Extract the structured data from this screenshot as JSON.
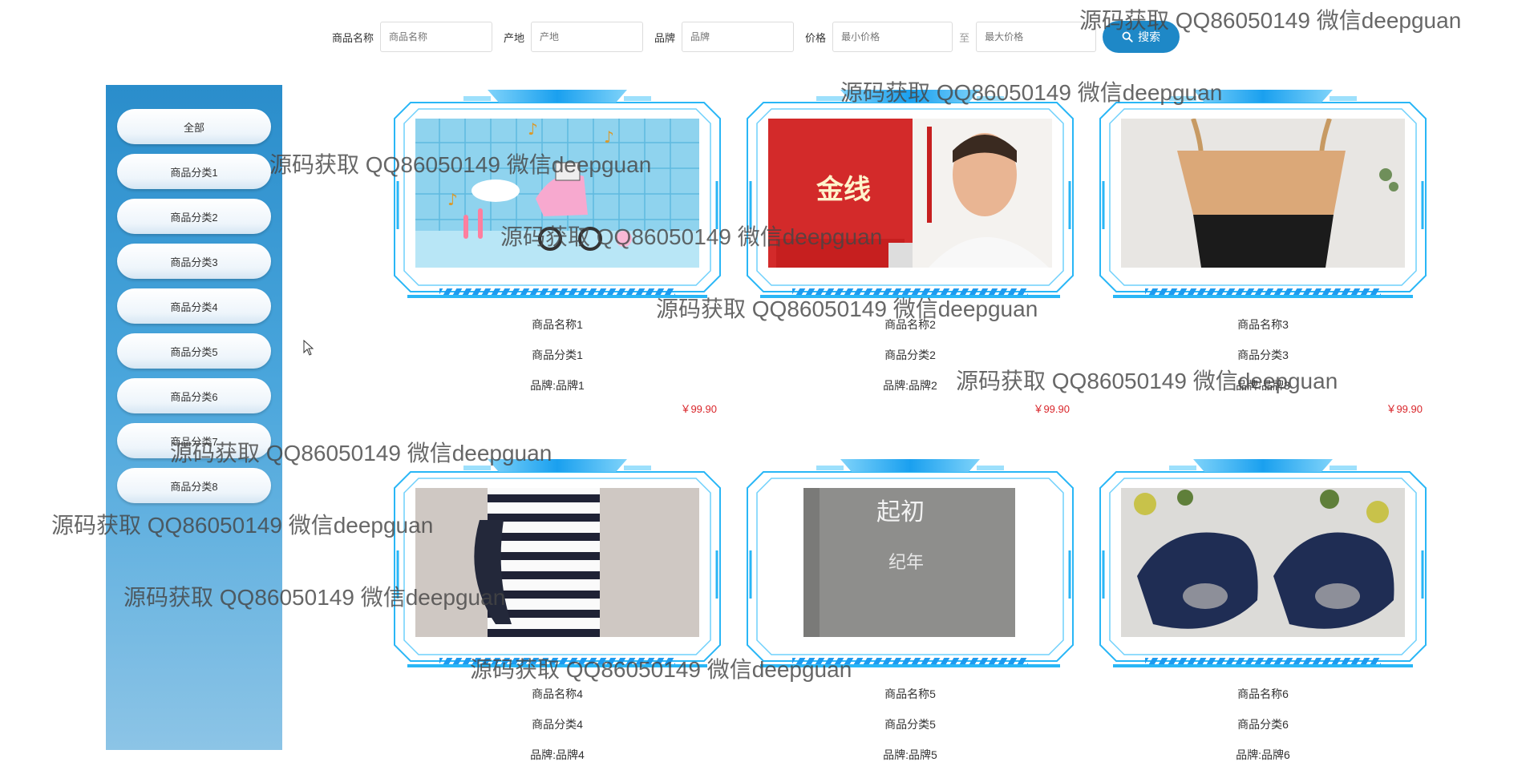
{
  "search": {
    "name_label": "商品名称",
    "name_placeholder": "商品名称",
    "origin_label": "产地",
    "origin_placeholder": "产地",
    "brand_label": "品牌",
    "brand_placeholder": "品牌",
    "price_label": "价格",
    "min_price_placeholder": "最小价格",
    "to_label": "至",
    "max_price_placeholder": "最大价格",
    "search_button": "搜索",
    "search_icon": "search-icon"
  },
  "sidebar": {
    "items": [
      {
        "label": "全部"
      },
      {
        "label": "商品分类1"
      },
      {
        "label": "商品分类2"
      },
      {
        "label": "商品分类3"
      },
      {
        "label": "商品分类4"
      },
      {
        "label": "商品分类5"
      },
      {
        "label": "商品分类6"
      },
      {
        "label": "商品分类7"
      },
      {
        "label": "商品分类8"
      }
    ]
  },
  "products": [
    {
      "name": "商品名称1",
      "category": "商品分类1",
      "brand": "品牌:品牌1",
      "price": "￥99.90",
      "image": "pink-stroller"
    },
    {
      "name": "商品名称2",
      "category": "商品分类2",
      "brand": "品牌:品牌2",
      "price": "￥99.90",
      "image": "book-jinxian"
    },
    {
      "name": "商品名称3",
      "category": "商品分类3",
      "brand": "品牌:品牌3",
      "price": "￥99.90",
      "image": "woven-bag"
    },
    {
      "name": "商品名称4",
      "category": "商品分类4",
      "brand": "品牌:品牌4",
      "price": "",
      "image": "striped-dress"
    },
    {
      "name": "商品名称5",
      "category": "商品分类5",
      "brand": "品牌:品牌5",
      "price": "",
      "image": "gray-book"
    },
    {
      "name": "商品名称6",
      "category": "商品分类6",
      "brand": "品牌:品牌6",
      "price": "",
      "image": "navy-shoes"
    }
  ],
  "image_text": {
    "book_title": "金线",
    "gray_book_title": "起初",
    "gray_book_sub": "纪年"
  },
  "watermark": "源码获取 QQ86050149 微信deepguan",
  "colors": {
    "accent": "#1e88c7",
    "sidebar_top": "#2a8dcb",
    "frame": "#29b6f6",
    "price": "#d9262b"
  }
}
